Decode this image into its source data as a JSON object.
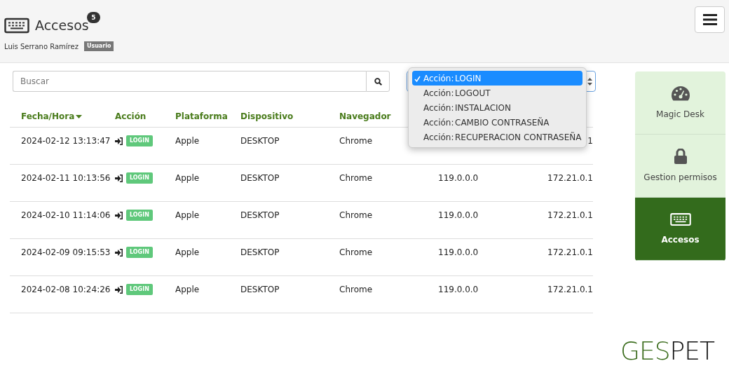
{
  "header": {
    "title": "Accesos",
    "count_badge": "5",
    "user": "Luis Serrano Ramírez",
    "role": "Usuario"
  },
  "search": {
    "placeholder": "Buscar"
  },
  "filter_dropdown": {
    "expanded": true,
    "options": [
      {
        "prefix": "Acción:",
        "label": "LOGIN",
        "selected": true
      },
      {
        "prefix": "Acción:",
        "label": "LOGOUT",
        "selected": false
      },
      {
        "prefix": "Acción:",
        "label": "INSTALACION",
        "selected": false
      },
      {
        "prefix": "Acción:",
        "label": "CAMBIO CONTRASEÑA",
        "selected": false
      },
      {
        "prefix": "Acción:",
        "label": "RECUPERACION CONTRASEÑA",
        "selected": false
      }
    ]
  },
  "table": {
    "columns": [
      {
        "label": "Fecha/Hora",
        "sorted": true
      },
      {
        "label": "Acción",
        "sorted": false
      },
      {
        "label": "Plataforma",
        "sorted": false
      },
      {
        "label": "Dispositivo",
        "sorted": false
      },
      {
        "label": "Navegador",
        "sorted": false
      }
    ],
    "rows": [
      {
        "cells": [
          "2024-02-12 13:13:47",
          "LOGIN",
          "Apple",
          "DESKTOP",
          "Chrome",
          null,
          "1"
        ]
      },
      {
        "cells": [
          "2024-02-11 10:13:56",
          "LOGIN",
          "Apple",
          "DESKTOP",
          "Chrome",
          "119.0.0.0",
          "172.21.0.1"
        ]
      },
      {
        "cells": [
          "2024-02-10 11:14:06",
          "LOGIN",
          "Apple",
          "DESKTOP",
          "Chrome",
          "119.0.0.0",
          "172.21.0.1"
        ]
      },
      {
        "cells": [
          "2024-02-09 09:15:53",
          "LOGIN",
          "Apple",
          "DESKTOP",
          "Chrome",
          "119.0.0.0",
          "172.21.0.1"
        ]
      },
      {
        "cells": [
          "2024-02-08 10:24:26",
          "LOGIN",
          "Apple",
          "DESKTOP",
          "Chrome",
          "119.0.0.0",
          "172.21.0.1"
        ]
      }
    ]
  },
  "sidebar": {
    "items": [
      {
        "label": "Magic Desk",
        "kind": "gauge",
        "selected": false
      },
      {
        "label": "Gestion permisos",
        "kind": "lock",
        "selected": false
      },
      {
        "label": "Accesos",
        "kind": "keyboard",
        "selected": true
      }
    ]
  },
  "logo": {
    "part_1": "GES",
    "part_2": "PET"
  }
}
